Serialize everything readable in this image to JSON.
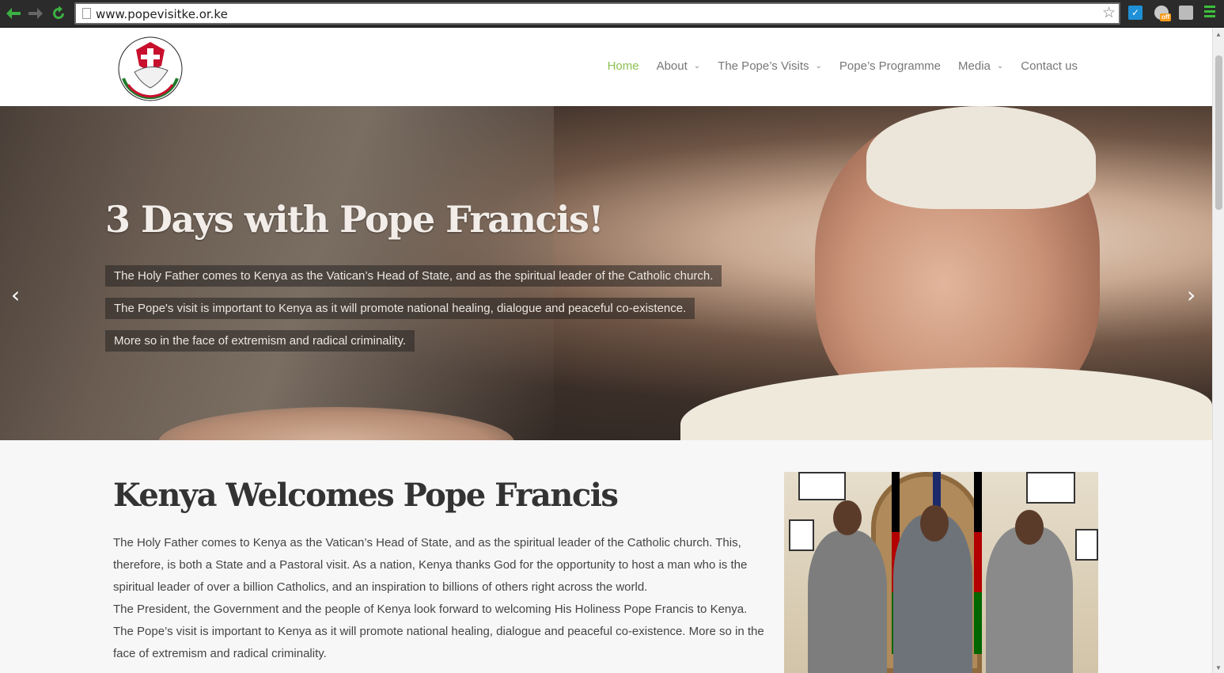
{
  "browser": {
    "url": "www.popevisitke.or.ke",
    "extension_badge": "off"
  },
  "nav": {
    "items": [
      {
        "label": "Home",
        "active": true,
        "dropdown": false
      },
      {
        "label": "About",
        "active": false,
        "dropdown": true
      },
      {
        "label": "The Pope’s Visits",
        "active": false,
        "dropdown": true
      },
      {
        "label": "Pope’s Programme",
        "active": false,
        "dropdown": false
      },
      {
        "label": "Media",
        "active": false,
        "dropdown": true
      },
      {
        "label": "Contact us",
        "active": false,
        "dropdown": false
      }
    ]
  },
  "logo": {
    "ring_text": "STAND FIRM IN FAITH · DO NOT BE AFRAID"
  },
  "hero": {
    "title": "3 Days with Pope Francis!",
    "lines": [
      "The Holy Father comes to Kenya as the Vatican’s Head of State, and as the spiritual leader of the Catholic church.",
      "The Pope's visit is important to Kenya as it will promote national healing, dialogue and peaceful co-existence.",
      "More so in the face of extremism and radical criminality."
    ],
    "prev_arrow": "‹",
    "next_arrow": "›"
  },
  "content": {
    "title": "Kenya Welcomes Pope Francis",
    "paragraphs": [
      "The Holy Father comes to Kenya as the Vatican’s Head of State, and as the spiritual leader of the Catholic church. This, therefore, is both a State and a Pastoral visit. As a nation, Kenya thanks God for the opportunity to host a man who is the spiritual leader of over a billion Catholics, and an inspiration to billions of others right across the world.",
      "The President, the Government and the people of Kenya look forward to welcoming His Holiness Pope Francis to Kenya. The Pope’s visit is important to Kenya as it will promote national healing, dialogue and peaceful co-existence. More so in the face of extremism and radical criminality."
    ]
  },
  "colors": {
    "active_nav": "#8cc152",
    "nav_text": "#777777",
    "page_bg": "#f7f7f7"
  }
}
